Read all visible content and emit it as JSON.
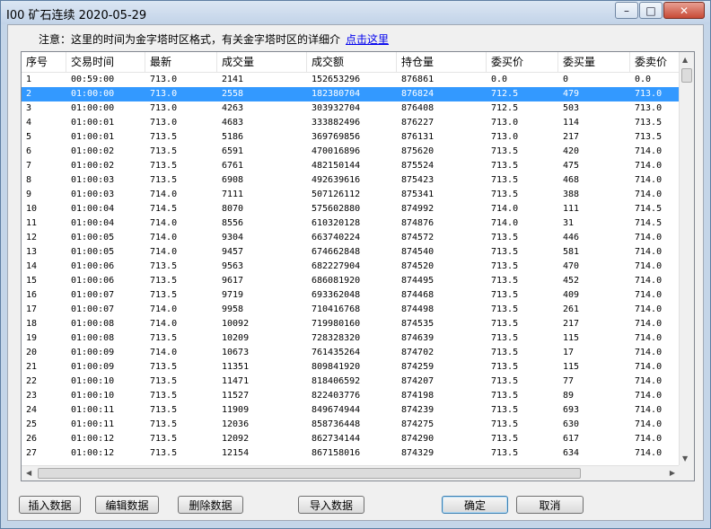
{
  "window": {
    "title": "I00 矿石连续 2020-05-29",
    "min_symbol": "–",
    "max_symbol": "□",
    "close_symbol": "✕"
  },
  "notice": {
    "text": "注意：这里的时间为金字塔时区格式，有关金字塔时区的详细介",
    "link": "点击这里"
  },
  "table": {
    "columns": [
      "序号",
      "交易时间",
      "最新",
      "成交量",
      "成交额",
      "持仓量",
      "委买价",
      "委买量",
      "委卖价"
    ],
    "selected_row": 1,
    "rows": [
      [
        "1",
        "00:59:00",
        "713.0",
        "2141",
        "152653296",
        "876861",
        "0.0",
        "0",
        "0.0"
      ],
      [
        "2",
        "01:00:00",
        "713.0",
        "2558",
        "182380704",
        "876824",
        "712.5",
        "479",
        "713.0"
      ],
      [
        "3",
        "01:00:00",
        "713.0",
        "4263",
        "303932704",
        "876408",
        "712.5",
        "503",
        "713.0"
      ],
      [
        "4",
        "01:00:01",
        "713.0",
        "4683",
        "333882496",
        "876227",
        "713.0",
        "114",
        "713.5"
      ],
      [
        "5",
        "01:00:01",
        "713.5",
        "5186",
        "369769856",
        "876131",
        "713.0",
        "217",
        "713.5"
      ],
      [
        "6",
        "01:00:02",
        "713.5",
        "6591",
        "470016896",
        "875620",
        "713.5",
        "420",
        "714.0"
      ],
      [
        "7",
        "01:00:02",
        "713.5",
        "6761",
        "482150144",
        "875524",
        "713.5",
        "475",
        "714.0"
      ],
      [
        "8",
        "01:00:03",
        "713.5",
        "6908",
        "492639616",
        "875423",
        "713.5",
        "468",
        "714.0"
      ],
      [
        "9",
        "01:00:03",
        "714.0",
        "7111",
        "507126112",
        "875341",
        "713.5",
        "388",
        "714.0"
      ],
      [
        "10",
        "01:00:04",
        "714.5",
        "8070",
        "575602880",
        "874992",
        "714.0",
        "111",
        "714.5"
      ],
      [
        "11",
        "01:00:04",
        "714.0",
        "8556",
        "610320128",
        "874876",
        "714.0",
        "31",
        "714.5"
      ],
      [
        "12",
        "01:00:05",
        "714.0",
        "9304",
        "663740224",
        "874572",
        "713.5",
        "446",
        "714.0"
      ],
      [
        "13",
        "01:00:05",
        "714.0",
        "9457",
        "674662848",
        "874540",
        "713.5",
        "581",
        "714.0"
      ],
      [
        "14",
        "01:00:06",
        "713.5",
        "9563",
        "682227904",
        "874520",
        "713.5",
        "470",
        "714.0"
      ],
      [
        "15",
        "01:00:06",
        "713.5",
        "9617",
        "686081920",
        "874495",
        "713.5",
        "452",
        "714.0"
      ],
      [
        "16",
        "01:00:07",
        "713.5",
        "9719",
        "693362048",
        "874468",
        "713.5",
        "409",
        "714.0"
      ],
      [
        "17",
        "01:00:07",
        "714.0",
        "9958",
        "710416768",
        "874498",
        "713.5",
        "261",
        "714.0"
      ],
      [
        "18",
        "01:00:08",
        "714.0",
        "10092",
        "719980160",
        "874535",
        "713.5",
        "217",
        "714.0"
      ],
      [
        "19",
        "01:00:08",
        "713.5",
        "10209",
        "728328320",
        "874639",
        "713.5",
        "115",
        "714.0"
      ],
      [
        "20",
        "01:00:09",
        "714.0",
        "10673",
        "761435264",
        "874702",
        "713.5",
        "17",
        "714.0"
      ],
      [
        "21",
        "01:00:09",
        "713.5",
        "11351",
        "809841920",
        "874259",
        "713.5",
        "115",
        "714.0"
      ],
      [
        "22",
        "01:00:10",
        "713.5",
        "11471",
        "818406592",
        "874207",
        "713.5",
        "77",
        "714.0"
      ],
      [
        "23",
        "01:00:10",
        "713.5",
        "11527",
        "822403776",
        "874198",
        "713.5",
        "89",
        "714.0"
      ],
      [
        "24",
        "01:00:11",
        "713.5",
        "11909",
        "849674944",
        "874239",
        "713.5",
        "693",
        "714.0"
      ],
      [
        "25",
        "01:00:11",
        "713.5",
        "12036",
        "858736448",
        "874275",
        "713.5",
        "630",
        "714.0"
      ],
      [
        "26",
        "01:00:12",
        "713.5",
        "12092",
        "862734144",
        "874290",
        "713.5",
        "617",
        "714.0"
      ],
      [
        "27",
        "01:00:12",
        "713.5",
        "12154",
        "867158016",
        "874329",
        "713.5",
        "634",
        "714.0"
      ]
    ]
  },
  "buttons": {
    "insert": "插入数据",
    "edit": "编辑数据",
    "delete": "删除数据",
    "import": "导入数据",
    "ok": "确定",
    "cancel": "取消"
  },
  "colors": {
    "selection": "#3399ff",
    "link": "#0000ee"
  }
}
